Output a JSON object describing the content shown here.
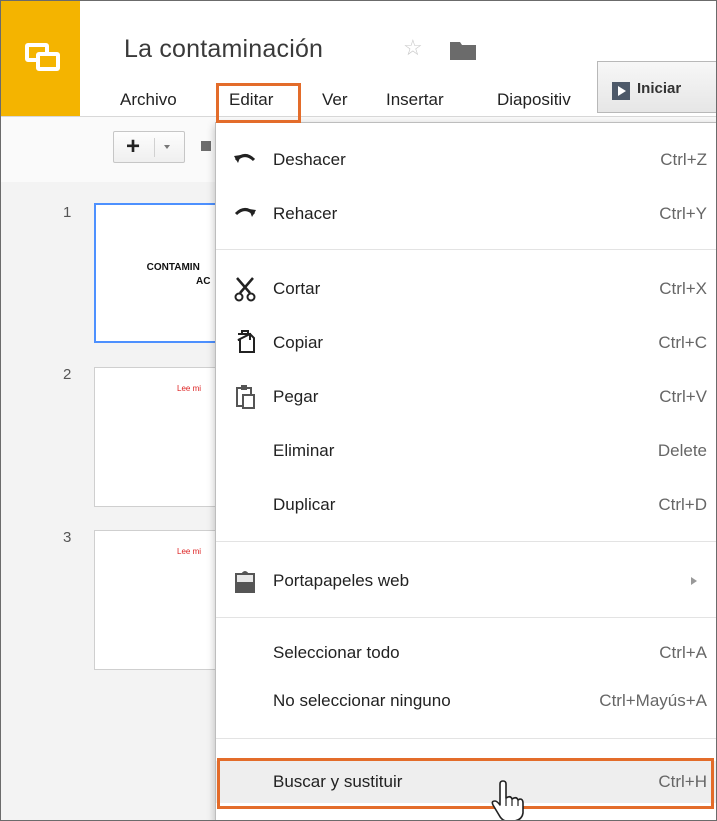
{
  "document": {
    "title": "La contaminación"
  },
  "menubar": {
    "items": [
      {
        "label": "Archivo"
      },
      {
        "label": "Editar"
      },
      {
        "label": "Ver"
      },
      {
        "label": "Insertar"
      },
      {
        "label": "Diapositiv"
      }
    ]
  },
  "present": {
    "label": "Iniciar"
  },
  "slides": [
    {
      "number": "1",
      "text_lines": [
        "CONTAMIN",
        "AC"
      ]
    },
    {
      "number": "2",
      "red_text": "Lee mi"
    },
    {
      "number": "3",
      "red_text": "Lee mi"
    }
  ],
  "edit_menu": {
    "items": [
      {
        "label": "Deshacer",
        "shortcut": "Ctrl+Z",
        "icon": "undo-icon"
      },
      {
        "label": "Rehacer",
        "shortcut": "Ctrl+Y",
        "icon": "redo-icon"
      },
      {
        "label": "Cortar",
        "shortcut": "Ctrl+X",
        "icon": "scissors-icon"
      },
      {
        "label": "Copiar",
        "shortcut": "Ctrl+C",
        "icon": "copy-icon"
      },
      {
        "label": "Pegar",
        "shortcut": "Ctrl+V",
        "icon": "paste-icon"
      },
      {
        "label": "Eliminar",
        "shortcut": "Delete"
      },
      {
        "label": "Duplicar",
        "shortcut": "Ctrl+D"
      },
      {
        "label": "Portapapeles web",
        "icon": "clipboard-icon"
      },
      {
        "label": "Seleccionar todo",
        "shortcut": "Ctrl+A"
      },
      {
        "label": "No seleccionar ninguno",
        "shortcut": "Ctrl+Mayús+A"
      },
      {
        "label": "Buscar y sustituir",
        "shortcut": "Ctrl+H",
        "state": "hovered"
      }
    ]
  },
  "colors": {
    "logo": "#f4b400",
    "highlight": "#e36c2a",
    "selected_slide_border": "#4d90fe"
  }
}
